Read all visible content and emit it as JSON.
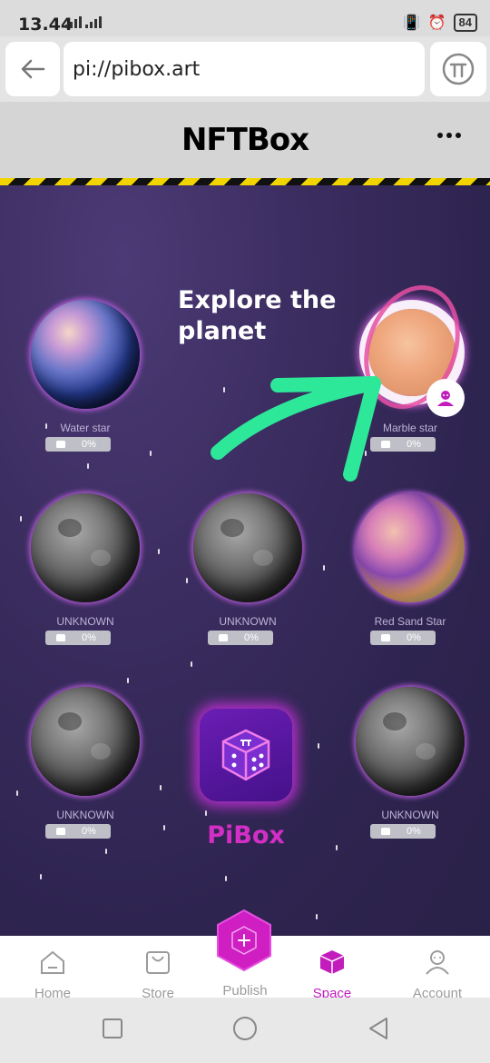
{
  "status_bar": {
    "time": "13.44",
    "battery": "84"
  },
  "browser": {
    "url": "pi://pibox.art"
  },
  "header": {
    "title": "NFTBox"
  },
  "space": {
    "explore_text": "Explore the planet",
    "planets": [
      {
        "name": "Water star",
        "progress": "0%"
      },
      {
        "name": "Marble star",
        "progress": "0%"
      },
      {
        "name": "UNKNOWN",
        "progress": "0%"
      },
      {
        "name": "UNKNOWN",
        "progress": "0%"
      },
      {
        "name": "Red Sand Star",
        "progress": "0%"
      },
      {
        "name": "UNKNOWN",
        "progress": "0%"
      },
      {
        "name": "UNKNOWN",
        "progress": "0%"
      }
    ],
    "brand": "PiBox"
  },
  "bottom_nav": {
    "items": [
      {
        "label": "Home",
        "icon": "home-icon"
      },
      {
        "label": "Store",
        "icon": "bag-icon"
      },
      {
        "label": "Publish",
        "icon": "plus-icon"
      },
      {
        "label": "Space",
        "icon": "cube-icon",
        "active": true
      },
      {
        "label": "Account",
        "icon": "person-icon"
      }
    ]
  },
  "colors": {
    "accent": "#c21cbd",
    "space_bg": "#352a5a",
    "arrow": "#2ee89a"
  }
}
